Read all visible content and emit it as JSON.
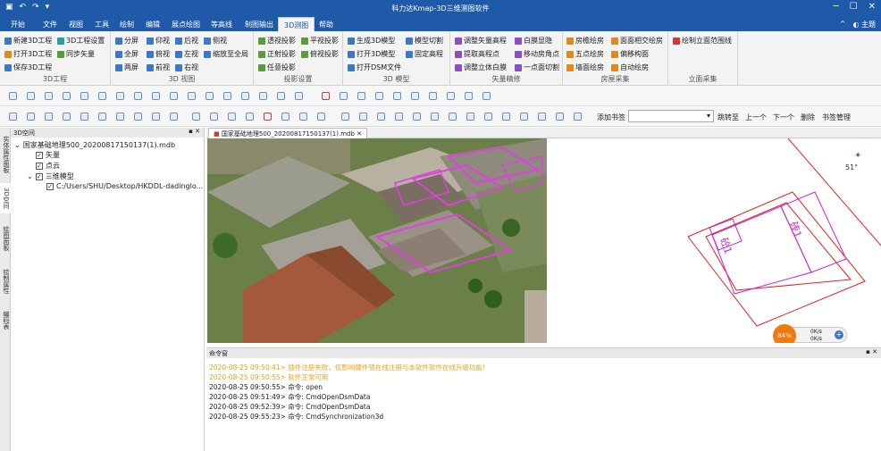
{
  "window": {
    "title": "科力达Kmap-3D三维测图软件"
  },
  "menu": {
    "tabs": [
      "开始",
      "文件",
      "视图",
      "工具",
      "绘制",
      "编辑",
      "展点绘图",
      "等高线",
      "制图输出",
      "3D测图",
      "帮助"
    ],
    "active": "3D测图",
    "right_theme": "主题"
  },
  "ribbon": {
    "g1": {
      "label": "3D工程",
      "items": [
        "新建3D工程",
        "3D工程设置",
        "打开3D工程",
        "同步矢量",
        "保存3D工程"
      ]
    },
    "g2": {
      "label": "3D 视图",
      "items": [
        "分屏",
        "仰视",
        "后视",
        "侧视",
        "全屏",
        "俯视",
        "左视",
        "缩放至全局",
        "两屏",
        "前视",
        "右视"
      ]
    },
    "g3": {
      "label": "投影设置",
      "items": [
        "透视投影",
        "平视投影",
        "正射投影",
        "俯视投影",
        "任意投影"
      ]
    },
    "g4": {
      "label": "3D 模型",
      "items": [
        "生成3D模型",
        "模型切割",
        "打开3D模型",
        "固定高程",
        "打开DSM文件"
      ]
    },
    "g5": {
      "label": "矢量精修",
      "items": [
        "调整矢量高程",
        "白膜显隐",
        "提取高程点",
        "移动房角点",
        "调整立体白膜",
        "一点面切割"
      ]
    },
    "g6": {
      "label": "房屋采集",
      "items": [
        "房檐绘房",
        "面面相交绘房",
        "五点绘房",
        "偏移构面",
        "墙面绘房",
        "自动绘房"
      ]
    },
    "g7": {
      "label": "立面采集",
      "items": [
        "绘制立面范围线"
      ]
    }
  },
  "toolbar2": {
    "bookmark_label": "添加书签",
    "bookmark_value": "",
    "jump": "跳转至",
    "prev": "上一个",
    "next": "下一个",
    "delete": "删除",
    "manage": "书签管理"
  },
  "left_tabs": [
    "实体属性面板",
    "3D空间",
    "绘图面板",
    "绘制属性",
    "编码表"
  ],
  "panel": {
    "title": "3D空间",
    "root": "国家基础地理500_20200817150137(1).mdb",
    "items": [
      "矢量",
      "点云",
      "三维模型",
      "C:/Users/SHU/Desktop/HKDDL-dadinglo..."
    ]
  },
  "document_tab": "国家基础地理500_20200817150137(1).mdb",
  "plan": {
    "compass": "51°",
    "labels": [
      "砖1",
      "砼1"
    ]
  },
  "status_widget": {
    "percent": "84%",
    "up": "0K/s",
    "down": "0K/s"
  },
  "command": {
    "title": "命令窗",
    "lines": [
      {
        "t": "2020-08-25 09:50:41> 插件注册失败，仅影响硬件锁在线注册与本软件软件在线升级功能!",
        "c": "#e8a317"
      },
      {
        "t": "2020-08-25 09:50:55> 软件正常可用",
        "c": "#e8a317"
      },
      {
        "t": "2020-08-25 09:50:55> 命令: open",
        "c": "#222222"
      },
      {
        "t": "2020-08-25 09:51:49> 命令: CmdOpenDsmData",
        "c": "#222222"
      },
      {
        "t": "2020-08-25 09:52:39> 命令: CmdOpenDsmData",
        "c": "#222222"
      },
      {
        "t": "2020-08-25 09:55:23> 命令: CmdSynchronization3d",
        "c": "#222222"
      }
    ]
  }
}
